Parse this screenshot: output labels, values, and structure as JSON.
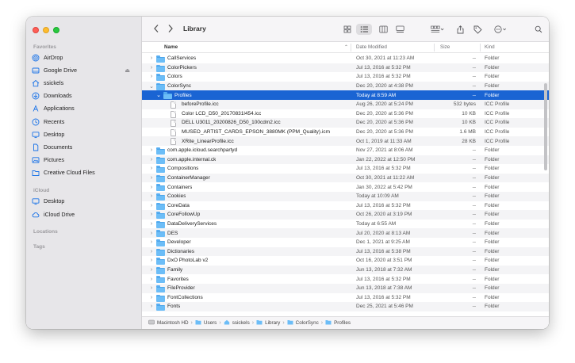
{
  "toolbar": {
    "title": "Library",
    "back_icon": "chevron-left-icon",
    "forward_icon": "chevron-right-icon"
  },
  "sidebar": {
    "favorites_heading": "Favorites",
    "favorites": [
      {
        "label": "AirDrop",
        "icon": "airdrop-icon"
      },
      {
        "label": "Google Drive",
        "icon": "drive-icon"
      },
      {
        "label": "ssickels",
        "icon": "home-icon"
      },
      {
        "label": "Downloads",
        "icon": "download-icon"
      },
      {
        "label": "Applications",
        "icon": "applications-icon"
      },
      {
        "label": "Recents",
        "icon": "clock-icon"
      },
      {
        "label": "Desktop",
        "icon": "desktop-icon"
      },
      {
        "label": "Documents",
        "icon": "document-icon"
      },
      {
        "label": "Pictures",
        "icon": "pictures-icon"
      },
      {
        "label": "Creative Cloud Files",
        "icon": "folder-icon"
      }
    ],
    "icloud_heading": "iCloud",
    "icloud": [
      {
        "label": "Desktop",
        "icon": "desktop-icon"
      },
      {
        "label": "iCloud Drive",
        "icon": "cloud-icon"
      }
    ],
    "locations_heading": "Locations",
    "tags_heading": "Tags"
  },
  "columns": {
    "name": "Name",
    "date": "Date Modified",
    "size": "Size",
    "kind": "Kind"
  },
  "rows": [
    {
      "name": "CallServices",
      "date": "Oct 30, 2021 at 11:23 AM",
      "size": "--",
      "kind": "Folder",
      "type": "folder",
      "level": 0,
      "open": false
    },
    {
      "name": "ColorPickers",
      "date": "Jul 13, 2016 at 5:32 PM",
      "size": "--",
      "kind": "Folder",
      "type": "folder",
      "level": 0,
      "open": false
    },
    {
      "name": "Colors",
      "date": "Jul 13, 2016 at 5:32 PM",
      "size": "--",
      "kind": "Folder",
      "type": "folder",
      "level": 0,
      "open": false
    },
    {
      "name": "ColorSync",
      "date": "Dec 20, 2020 at 4:38 PM",
      "size": "--",
      "kind": "Folder",
      "type": "folder",
      "level": 0,
      "open": true
    },
    {
      "name": "Profiles",
      "date": "Today at 8:59 AM",
      "size": "--",
      "kind": "Folder",
      "type": "folder",
      "level": 1,
      "open": true,
      "selected": true
    },
    {
      "name": "beforeProfile.icc",
      "date": "Aug 26, 2020 at 5:24 PM",
      "size": "532 bytes",
      "kind": "ICC Profile",
      "type": "file",
      "level": 2
    },
    {
      "name": "Color LCD_D50_20170831l454.icc",
      "date": "Dec 20, 2020 at 5:36 PM",
      "size": "10 KB",
      "kind": "ICC Profile",
      "type": "file",
      "level": 2
    },
    {
      "name": "DELL U3011_20200826_D50_100cdm2.icc",
      "date": "Dec 20, 2020 at 5:36 PM",
      "size": "10 KB",
      "kind": "ICC Profile",
      "type": "file",
      "level": 2
    },
    {
      "name": "MUSEO_ARTIST_CARDS_EPSON_3880MK (PPM_Quality).icm",
      "date": "Dec 20, 2020 at 5:36 PM",
      "size": "1.6 MB",
      "kind": "ICC Profile",
      "type": "file",
      "level": 2
    },
    {
      "name": "XRite_LinearProfile.icc",
      "date": "Oct 1, 2019 at 11:33 AM",
      "size": "28 KB",
      "kind": "ICC Profile",
      "type": "file",
      "level": 2
    },
    {
      "name": "com.apple.icloud.searchpartyd",
      "date": "Nov 27, 2021 at 8:06 AM",
      "size": "--",
      "kind": "Folder",
      "type": "folder",
      "level": 0,
      "open": false
    },
    {
      "name": "com.apple.internal.ck",
      "date": "Jan 22, 2022 at 12:50 PM",
      "size": "--",
      "kind": "Folder",
      "type": "folder",
      "level": 0,
      "open": false
    },
    {
      "name": "Compositions",
      "date": "Jul 13, 2016 at 5:32 PM",
      "size": "--",
      "kind": "Folder",
      "type": "folder",
      "level": 0,
      "open": false
    },
    {
      "name": "ContainerManager",
      "date": "Oct 30, 2021 at 11:22 AM",
      "size": "--",
      "kind": "Folder",
      "type": "folder",
      "level": 0,
      "open": false
    },
    {
      "name": "Containers",
      "date": "Jan 30, 2022 at 5:42 PM",
      "size": "--",
      "kind": "Folder",
      "type": "folder",
      "level": 0,
      "open": false
    },
    {
      "name": "Cookies",
      "date": "Today at 10:09 AM",
      "size": "--",
      "kind": "Folder",
      "type": "folder",
      "level": 0,
      "open": false
    },
    {
      "name": "CoreData",
      "date": "Jul 13, 2016 at 5:32 PM",
      "size": "--",
      "kind": "Folder",
      "type": "folder",
      "level": 0,
      "open": false
    },
    {
      "name": "CoreFollowUp",
      "date": "Oct 26, 2020 at 3:19 PM",
      "size": "--",
      "kind": "Folder",
      "type": "folder",
      "level": 0,
      "open": false
    },
    {
      "name": "DataDeliveryServices",
      "date": "Today at 6:55 AM",
      "size": "--",
      "kind": "Folder",
      "type": "folder",
      "level": 0,
      "open": false
    },
    {
      "name": "DES",
      "date": "Jul 20, 2020 at 8:13 AM",
      "size": "--",
      "kind": "Folder",
      "type": "folder",
      "level": 0,
      "open": false
    },
    {
      "name": "Developer",
      "date": "Dec 1, 2021 at 9:25 AM",
      "size": "--",
      "kind": "Folder",
      "type": "folder",
      "level": 0,
      "open": false
    },
    {
      "name": "Dictionaries",
      "date": "Jul 13, 2016 at 5:38 PM",
      "size": "--",
      "kind": "Folder",
      "type": "folder",
      "level": 0,
      "open": false
    },
    {
      "name": "DxO PhotoLab v2",
      "date": "Oct 16, 2020 at 3:51 PM",
      "size": "--",
      "kind": "Folder",
      "type": "folder",
      "level": 0,
      "open": false
    },
    {
      "name": "Family",
      "date": "Jun 13, 2018 at 7:32 AM",
      "size": "--",
      "kind": "Folder",
      "type": "folder",
      "level": 0,
      "open": false
    },
    {
      "name": "Favorites",
      "date": "Jul 13, 2016 at 5:32 PM",
      "size": "--",
      "kind": "Folder",
      "type": "folder",
      "level": 0,
      "open": false
    },
    {
      "name": "FileProvider",
      "date": "Jun 13, 2018 at 7:38 AM",
      "size": "--",
      "kind": "Folder",
      "type": "folder",
      "level": 0,
      "open": false
    },
    {
      "name": "FontCollections",
      "date": "Jul 13, 2016 at 5:32 PM",
      "size": "--",
      "kind": "Folder",
      "type": "folder",
      "level": 0,
      "open": false
    },
    {
      "name": "Fonts",
      "date": "Dec 25, 2021 at 5:46 PM",
      "size": "--",
      "kind": "Folder",
      "type": "folder",
      "level": 0,
      "open": false
    }
  ],
  "pathbar": [
    {
      "label": "Macintosh HD",
      "icon": "disk-icon"
    },
    {
      "label": "Users",
      "icon": "folder-icon"
    },
    {
      "label": "ssickels",
      "icon": "home-icon"
    },
    {
      "label": "Library",
      "icon": "folder-icon"
    },
    {
      "label": "ColorSync",
      "icon": "folder-icon"
    },
    {
      "label": "Profiles",
      "icon": "folder-icon"
    }
  ],
  "colors": {
    "accent": "#1a64d3",
    "folder": "#6cbdf7",
    "sidebar_icon": "#1a73e8"
  }
}
